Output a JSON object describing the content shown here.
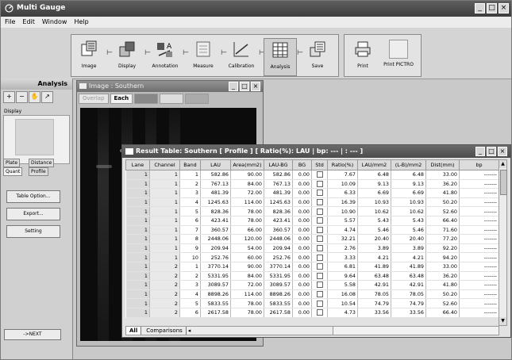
{
  "app": {
    "title": "Multi Gauge"
  },
  "menu": [
    "File",
    "Edit",
    "Window",
    "Help"
  ],
  "toolbar": {
    "steps": [
      "Image",
      "Display",
      "Annotation",
      "Measure",
      "Calibration",
      "Analysis",
      "Save"
    ],
    "print": "Print",
    "print_pictro": "Print PICTRO"
  },
  "left_panel": {
    "header": "Analysis",
    "display_label": "Display",
    "tab_plate": "Plate",
    "tab_quant": "Quant",
    "tab_distance": "Distance",
    "tab_profile": "Profile",
    "table_option_button": "Table Option...",
    "export_button": "Export...",
    "setting_button": "Setting",
    "next_button": "->NEXT"
  },
  "image_window": {
    "title": "Image : Southern",
    "tab_overlap": "Overlap",
    "tab_each": "Each"
  },
  "result_window": {
    "title": "Result Table: Southern [ Profile ] [ Ratio(%): LAU | bp: --- | : --- ]",
    "columns": [
      "Lane",
      "Channel",
      "Band",
      "LAU",
      "Area(mm2)",
      "LAU-BG",
      "BG",
      "Std",
      "Ratio(%)",
      "LAU/mm2",
      "(L-B)/mm2",
      "Dist(mm)",
      "bp"
    ],
    "rows": [
      [
        "1",
        "1",
        "1",
        "582.86",
        "90.00",
        "582.86",
        "0.00",
        "",
        "7.67",
        "6.48",
        "6.48",
        "33.00",
        "-------"
      ],
      [
        "1",
        "1",
        "2",
        "767.13",
        "84.00",
        "767.13",
        "0.00",
        "",
        "10.09",
        "9.13",
        "9.13",
        "36.20",
        "-------"
      ],
      [
        "1",
        "1",
        "3",
        "481.39",
        "72.00",
        "481.39",
        "0.00",
        "",
        "6.33",
        "6.69",
        "6.69",
        "41.80",
        "-------"
      ],
      [
        "1",
        "1",
        "4",
        "1245.63",
        "114.00",
        "1245.63",
        "0.00",
        "",
        "16.39",
        "10.93",
        "10.93",
        "50.20",
        "-------"
      ],
      [
        "1",
        "1",
        "5",
        "828.36",
        "78.00",
        "828.36",
        "0.00",
        "",
        "10.90",
        "10.62",
        "10.62",
        "52.60",
        "-------"
      ],
      [
        "1",
        "1",
        "6",
        "423.41",
        "78.00",
        "423.41",
        "0.00",
        "",
        "5.57",
        "5.43",
        "5.43",
        "66.40",
        "-------"
      ],
      [
        "1",
        "1",
        "7",
        "360.57",
        "66.00",
        "360.57",
        "0.00",
        "",
        "4.74",
        "5.46",
        "5.46",
        "71.60",
        "-------"
      ],
      [
        "1",
        "1",
        "8",
        "2448.06",
        "120.00",
        "2448.06",
        "0.00",
        "",
        "32.21",
        "20.40",
        "20.40",
        "77.20",
        "-------"
      ],
      [
        "1",
        "1",
        "9",
        "209.94",
        "54.00",
        "209.94",
        "0.00",
        "",
        "2.76",
        "3.89",
        "3.89",
        "92.20",
        "-------"
      ],
      [
        "1",
        "1",
        "10",
        "252.76",
        "60.00",
        "252.76",
        "0.00",
        "",
        "3.33",
        "4.21",
        "4.21",
        "94.20",
        "-------"
      ],
      [
        "1",
        "2",
        "1",
        "3770.14",
        "90.00",
        "3770.14",
        "0.00",
        "",
        "6.81",
        "41.89",
        "41.89",
        "33.00",
        "-------"
      ],
      [
        "1",
        "2",
        "2",
        "5331.95",
        "84.00",
        "5331.95",
        "0.00",
        "",
        "9.64",
        "63.48",
        "63.48",
        "36.20",
        "-------"
      ],
      [
        "1",
        "2",
        "3",
        "3089.57",
        "72.00",
        "3089.57",
        "0.00",
        "",
        "5.58",
        "42.91",
        "42.91",
        "41.80",
        "-------"
      ],
      [
        "1",
        "2",
        "4",
        "8898.26",
        "114.00",
        "8898.26",
        "0.00",
        "",
        "16.08",
        "78.05",
        "78.05",
        "50.20",
        "-------"
      ],
      [
        "1",
        "2",
        "5",
        "5833.55",
        "78.00",
        "5833.55",
        "0.00",
        "",
        "10.54",
        "74.79",
        "74.79",
        "52.60",
        "-------"
      ],
      [
        "1",
        "2",
        "6",
        "2617.58",
        "78.00",
        "2617.58",
        "0.00",
        "",
        "4.73",
        "33.56",
        "33.56",
        "66.40",
        "-------"
      ]
    ],
    "tabs": [
      "All",
      "Comparisons"
    ]
  }
}
